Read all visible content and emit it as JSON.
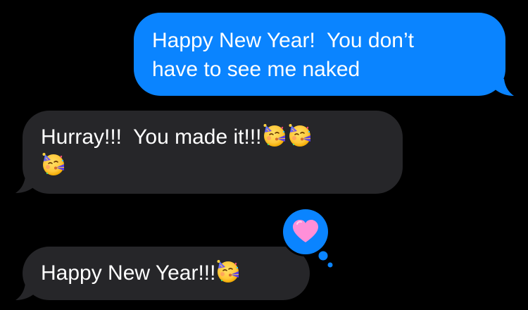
{
  "colors": {
    "background": "#000000",
    "sent_bubble": "#0a84ff",
    "received_bubble": "#262629",
    "text": "#ffffff",
    "tapback_heart": "#ff8fd8"
  },
  "messages": [
    {
      "direction": "sent",
      "lines": [
        "Happy New Year!  You don’t",
        "have to see me naked"
      ]
    },
    {
      "direction": "received",
      "lines": [
        "Hurray!!!  You made it!!!"
      ],
      "emoji_count": 3,
      "emoji_name": "partying-face-emoji"
    },
    {
      "direction": "received",
      "lines": [
        "Happy New Year!!!"
      ],
      "emoji_count": 1,
      "emoji_name": "partying-face-emoji",
      "tapback": "heart"
    }
  ]
}
